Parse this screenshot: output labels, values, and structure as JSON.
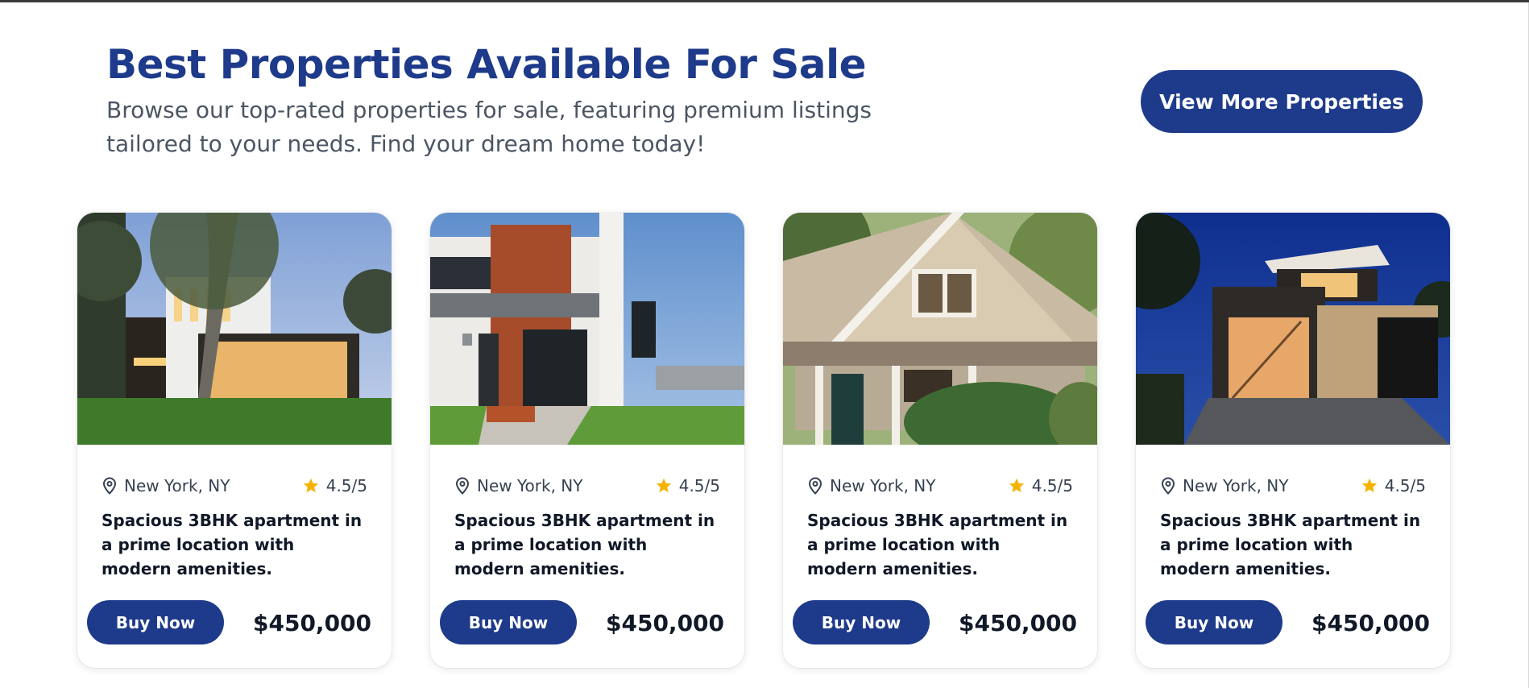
{
  "header": {
    "title": "Best Properties Available For Sale",
    "subtitle": "Browse our top-rated properties for sale, featuring premium listings tailored to your needs. Find your dream home today!",
    "view_more_label": "View More Properties"
  },
  "colors": {
    "brand": "#1e3a8a",
    "star": "#f5b301"
  },
  "listings": [
    {
      "location": "New York, NY",
      "rating": "4.5/5",
      "description": "Spacious 3BHK apartment in a prime location with modern amenities.",
      "buy_label": "Buy Now",
      "price": "$450,000",
      "image": "modern-house-dusk-photo"
    },
    {
      "location": "New York, NY",
      "rating": "4.5/5",
      "description": "Spacious 3BHK apartment in a prime location with modern amenities.",
      "buy_label": "Buy Now",
      "price": "$450,000",
      "image": "modern-house-daylight-photo"
    },
    {
      "location": "New York, NY",
      "rating": "4.5/5",
      "description": "Spacious 3BHK apartment in a prime location with modern amenities.",
      "buy_label": "Buy Now",
      "price": "$450,000",
      "image": "suburban-house-photo"
    },
    {
      "location": "New York, NY",
      "rating": "4.5/5",
      "description": "Spacious 3BHK apartment in a prime location with modern amenities.",
      "buy_label": "Buy Now",
      "price": "$450,000",
      "image": "modern-house-night-photo"
    }
  ]
}
